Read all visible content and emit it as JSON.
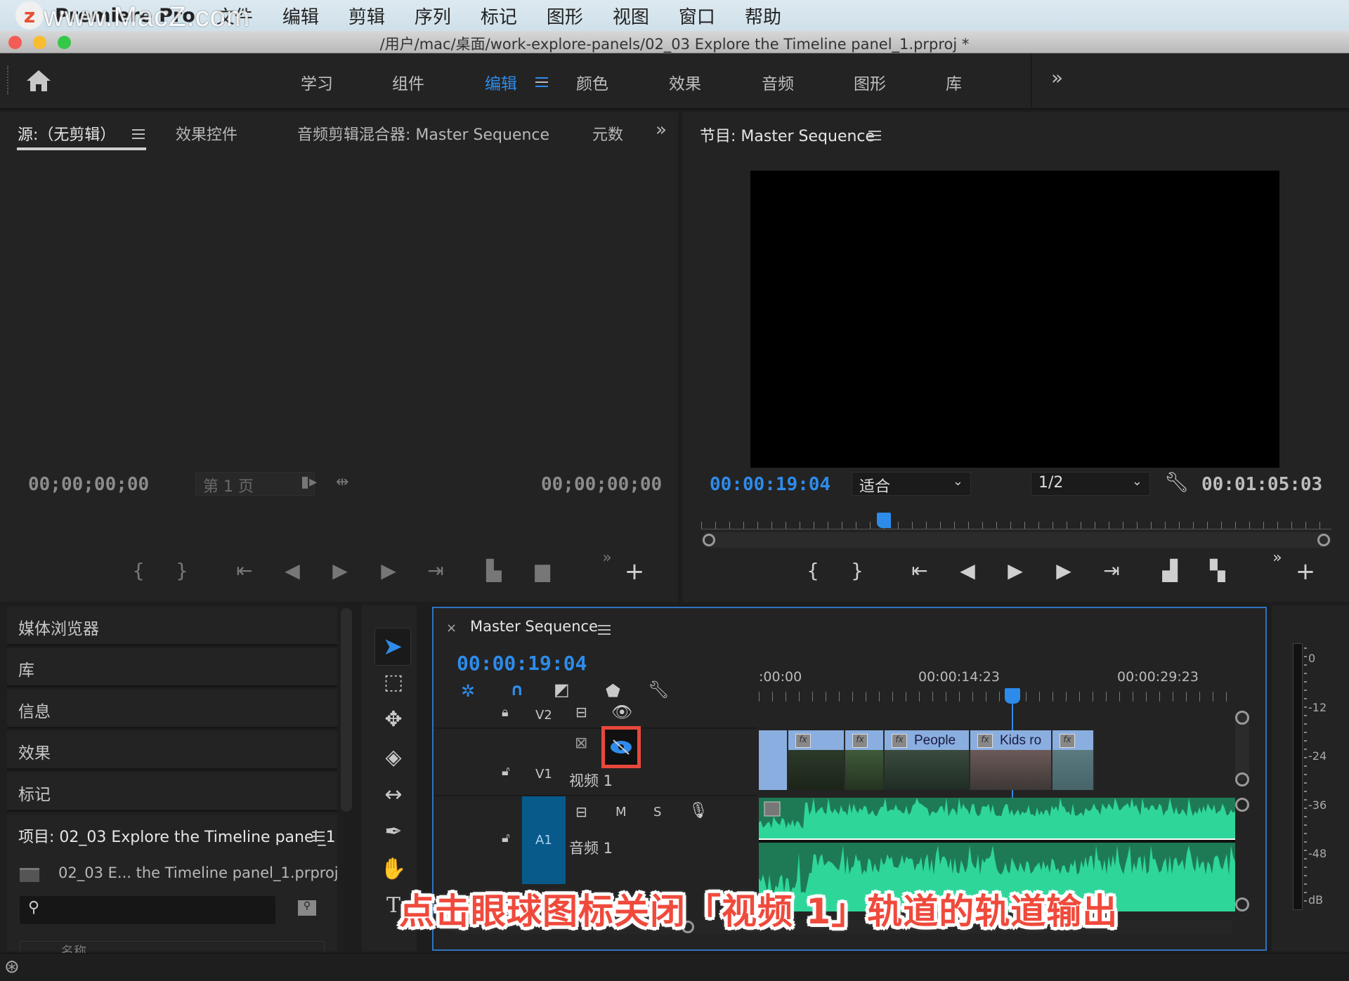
{
  "menubar": {
    "app_name": "Premiere Pro",
    "watermark": "www.MacZ.com",
    "items": [
      "文件",
      "编辑",
      "剪辑",
      "序列",
      "标记",
      "图形",
      "视图",
      "窗口",
      "帮助"
    ]
  },
  "titlebar": {
    "title": "/用户/mac/桌面/work-explore-panels/02_03 Explore the Timeline panel_1.prproj *"
  },
  "workspaces": {
    "items": [
      "学习",
      "组件",
      "编辑",
      "颜色",
      "效果",
      "音频",
      "图形",
      "库"
    ],
    "active": "编辑",
    "more": "»"
  },
  "source_panel": {
    "tabs": [
      "源:（无剪辑）",
      "效果控件",
      "音频剪辑混合器: Master Sequence",
      "元数"
    ],
    "timecode_in": "00;00;00;00",
    "timecode_out": "00;00;00;00",
    "page_select": "第 1 页",
    "more": "»",
    "add": "+"
  },
  "program_panel": {
    "title": "节目: Master Sequence",
    "current_time": "00:00:19:04",
    "fit_select": "适合",
    "resolution_select": "1/2",
    "duration": "00:01:05:03",
    "playhead_fraction": 0.29,
    "more": "»",
    "add": "+"
  },
  "left_stack": {
    "items": [
      "媒体浏览器",
      "库",
      "信息",
      "效果",
      "标记"
    ],
    "project_title": "项目: 02_03 Explore the Timeline panel_1",
    "project_file": "02_03 E... the Timeline panel_1.prproj",
    "search_placeholder": "",
    "column_name": "名称"
  },
  "timeline": {
    "sequence_name": "Master Sequence",
    "timecode": "00:00:19:04",
    "ruler_labels": [
      ":00:00",
      "00:00:14:23",
      "00:00:29:23"
    ],
    "tracks": {
      "v2": {
        "label": "V2"
      },
      "v1": {
        "label": "V1",
        "name": "视频 1",
        "output_enabled": false
      },
      "a1": {
        "label": "A1",
        "name": "音频 1",
        "mute": "M",
        "solo": "S"
      }
    },
    "clips": [
      {
        "name": ""
      },
      {
        "name": ""
      },
      {
        "name": ""
      },
      {
        "name": "People"
      },
      {
        "name": "Kids ro"
      },
      {
        "name": ""
      }
    ],
    "accent_color": "#2d8ceb",
    "highlight_color": "#e8473c"
  },
  "audio_meter": {
    "labels": [
      "0",
      "-12",
      "-24",
      "-36",
      "-48",
      "dB"
    ]
  },
  "caption": "点击眼球图标关闭「视频 1」轨道的轨道输出"
}
